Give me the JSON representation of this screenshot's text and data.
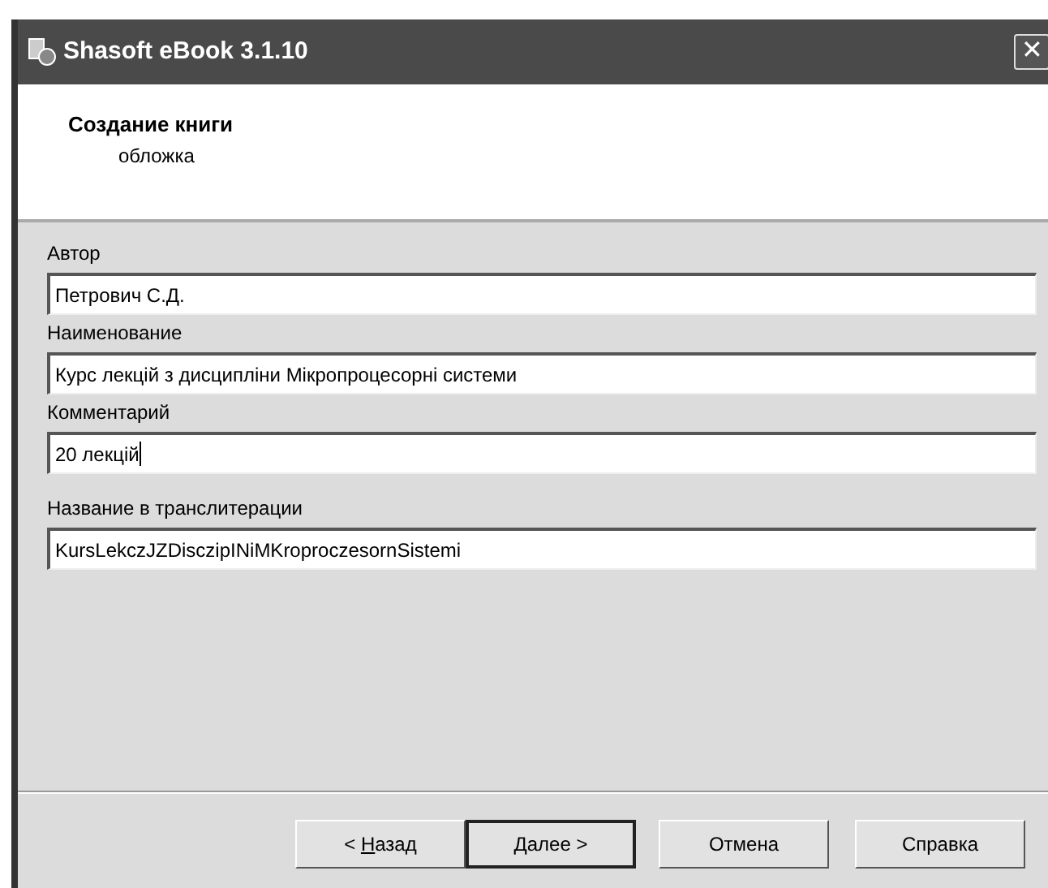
{
  "window": {
    "title": "Shasoft eBook 3.1.10",
    "close": "✕"
  },
  "header": {
    "title": "Создание книги",
    "subtitle": "обложка"
  },
  "fields": [
    {
      "label": "Автор",
      "value": "Петрович С.Д.",
      "focused": false
    },
    {
      "label": "Наименование",
      "value": "Курс лекцій з дисципліни Мікропроцесорні системи",
      "focused": false
    },
    {
      "label": "Комментарий",
      "value": "20 лекцій",
      "focused": true
    },
    {
      "label": "Название в транслитерации",
      "value": "KursLekczJZDisczipINiMKroproczesornSistemi",
      "focused": false
    }
  ],
  "buttons": [
    {
      "before": "< ",
      "key": "Н",
      "after": "азад",
      "default": false
    },
    {
      "key": "Д",
      "after": "алее >",
      "default": true
    },
    {
      "after": "Отмена",
      "default": false
    },
    {
      "after": "Справка",
      "default": false
    }
  ]
}
